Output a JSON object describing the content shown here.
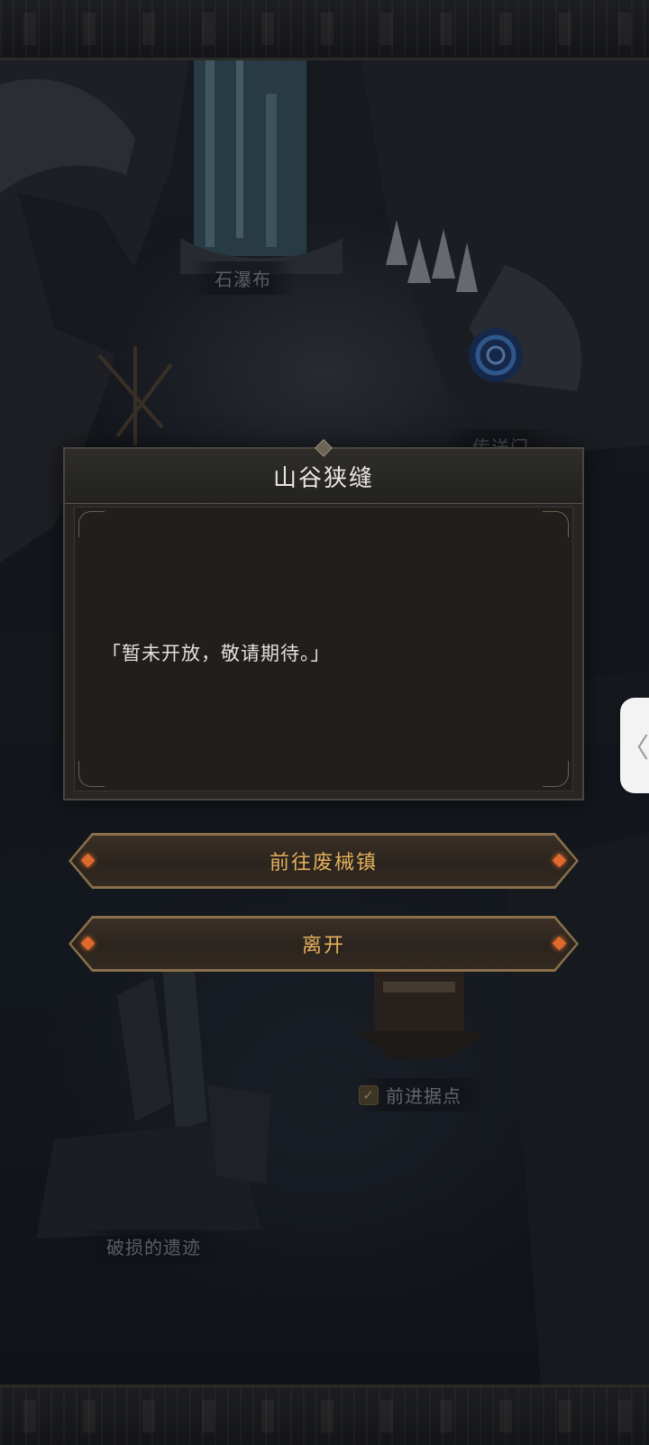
{
  "map": {
    "labels": {
      "stone_waterfall": "石瀑布",
      "forward_base": "前进据点",
      "broken_ruins": "破损的遗迹",
      "teleport_gate_partial": "传送门"
    },
    "forward_base_checked": true
  },
  "dialog": {
    "title": "山谷狭缝",
    "message": "「暂未开放，敬请期待。」"
  },
  "actions": {
    "goto_label": "前往废械镇",
    "leave_label": "离开"
  },
  "side_tab": {
    "icon": "chevron-left-icon",
    "glyph": "〈"
  },
  "colors": {
    "button_text": "#e3b05c",
    "button_border": "#8a6f4a",
    "dialog_bg": "#272624",
    "gem": "#e06a2e"
  }
}
